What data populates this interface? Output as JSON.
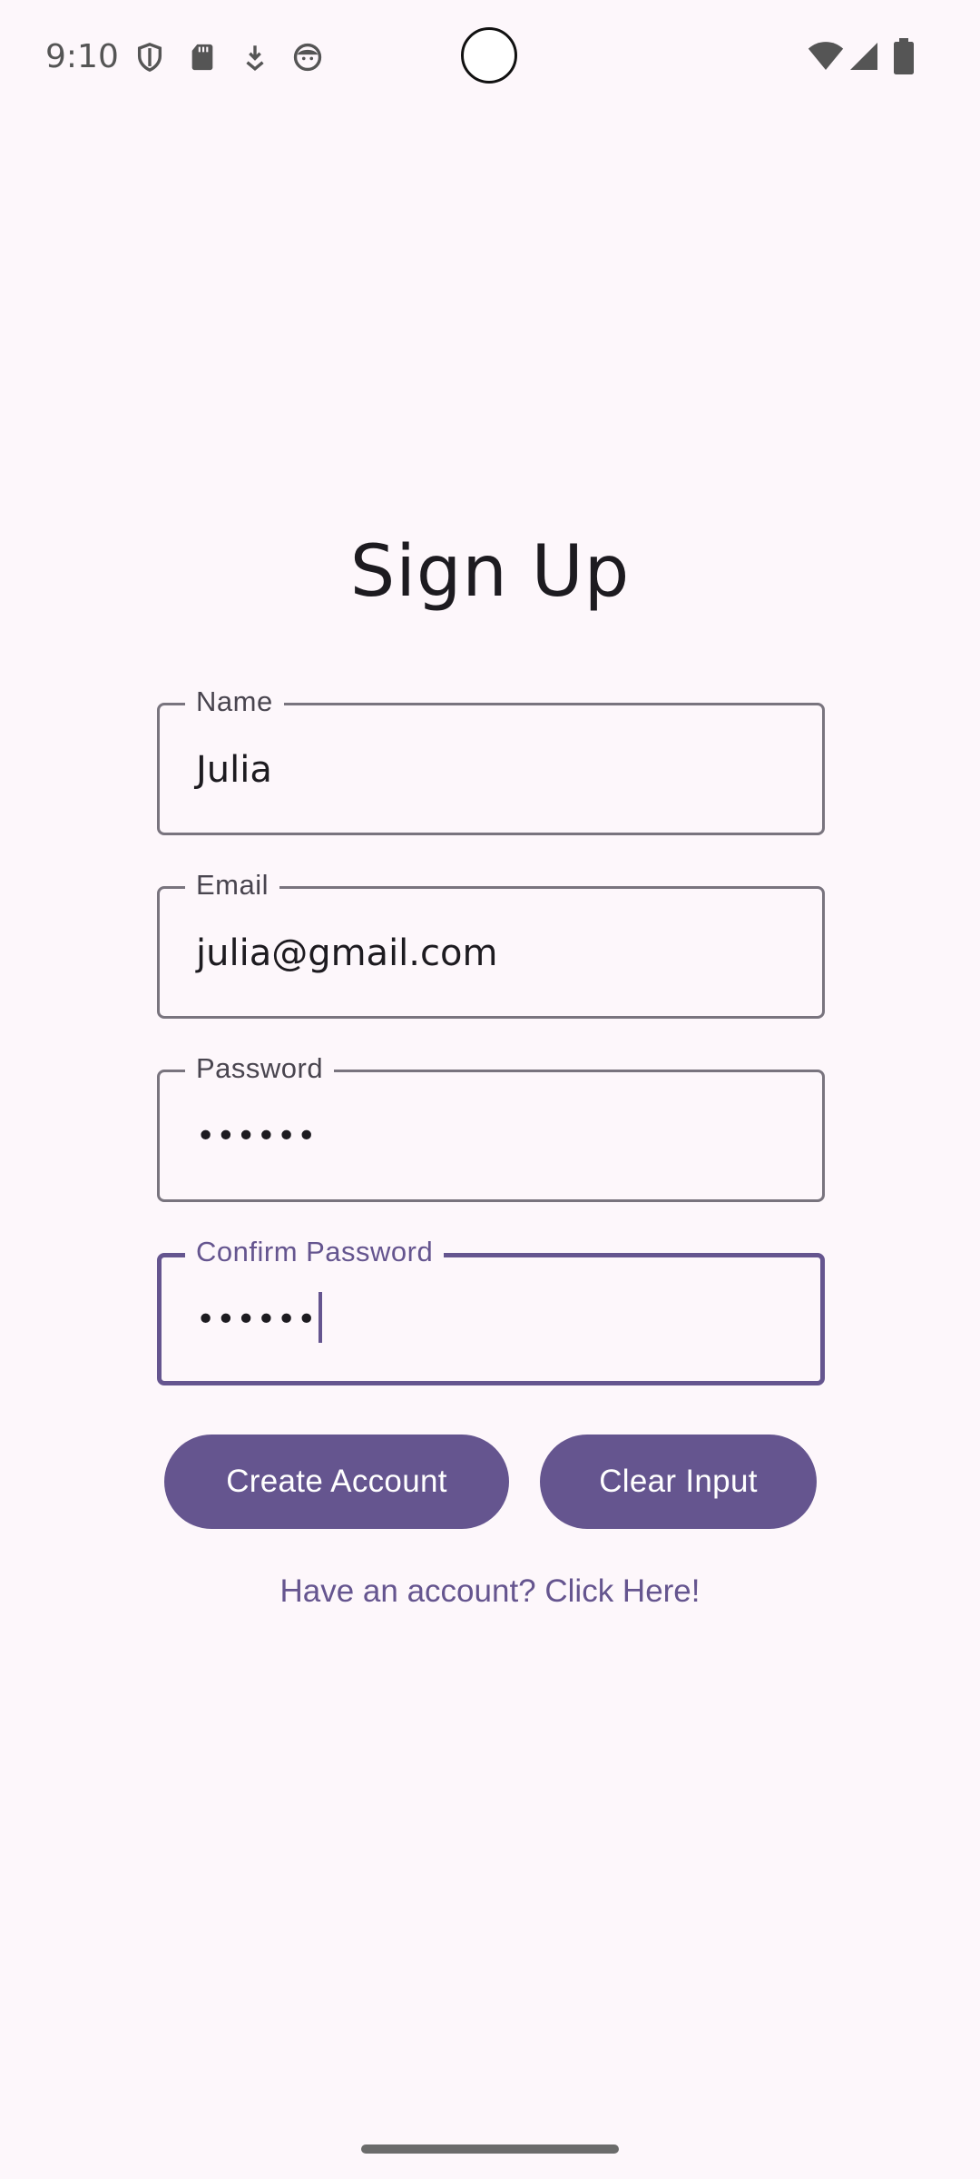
{
  "status_bar": {
    "time": "9:10",
    "left_icons": [
      "shield-icon",
      "sd-card-icon",
      "download-icon",
      "face-icon"
    ],
    "right_icons": [
      "wifi-icon",
      "signal-icon",
      "battery-icon"
    ]
  },
  "screen": {
    "title": "Sign Up"
  },
  "form": {
    "name": {
      "label": "Name",
      "value": "Julia"
    },
    "email": {
      "label": "Email",
      "value": "julia@gmail.com"
    },
    "password": {
      "label": "Password",
      "value": "••••••"
    },
    "confirm_password": {
      "label": "Confirm Password",
      "value": "••••••",
      "focused": true
    }
  },
  "buttons": {
    "create_account": "Create Account",
    "clear_input": "Clear Input"
  },
  "link": {
    "login": "Have an account? Click Here!"
  },
  "colors": {
    "background": "#fdf7fb",
    "primary": "#65558f",
    "outline": "#79747e",
    "text": "#1d1b20"
  }
}
